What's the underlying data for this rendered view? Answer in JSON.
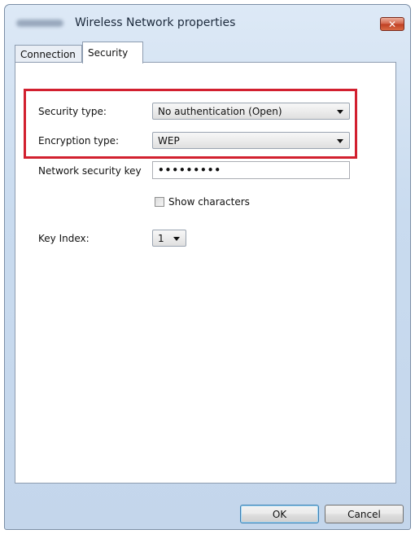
{
  "window": {
    "title": "Wireless Network properties"
  },
  "tabs": [
    {
      "label": "Connection",
      "selected": false
    },
    {
      "label": "Security",
      "selected": true
    }
  ],
  "security": {
    "security_type": {
      "label": "Security type:",
      "value": "No authentication (Open)"
    },
    "encryption_type": {
      "label": "Encryption type:",
      "value": "WEP"
    },
    "network_key": {
      "label": "Network security key",
      "value": "•••••••••"
    },
    "show_characters": {
      "label": "Show characters",
      "checked": false
    },
    "key_index": {
      "label": "Key Index:",
      "value": "1"
    }
  },
  "buttons": {
    "ok": "OK",
    "cancel": "Cancel"
  },
  "colors": {
    "highlight_box": "#d2202f",
    "window_frame": "#c9dbef"
  },
  "icons": {
    "close": "close-x-icon",
    "dropdown": "chevron-down-icon"
  }
}
